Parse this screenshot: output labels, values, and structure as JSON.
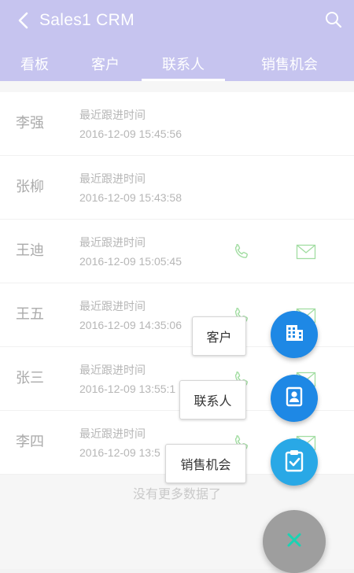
{
  "header": {
    "title": "Sales1 CRM",
    "background": "#b0aee9"
  },
  "tabs": [
    {
      "label": "看板",
      "active": false
    },
    {
      "label": "客户",
      "active": false
    },
    {
      "label": "联系人",
      "active": true
    },
    {
      "label": "销售机会",
      "active": false
    }
  ],
  "contacts": [
    {
      "name": "李强",
      "label": "最近跟进时间",
      "time": "2016-12-09 15:45:56"
    },
    {
      "name": "张柳",
      "label": "最近跟进时间",
      "time": "2016-12-09 15:43:58"
    },
    {
      "name": "王迪",
      "label": "最近跟进时间",
      "time": "2016-12-09 15:05:45"
    },
    {
      "name": "王五",
      "label": "最近跟进时间",
      "time": "2016-12-09 14:35:06"
    },
    {
      "name": "张三",
      "label": "最近跟进时间",
      "time": "2016-12-09 13:55:1"
    },
    {
      "name": "李四",
      "label": "最近跟进时间",
      "time": "2016-12-09 13:5"
    }
  ],
  "footer": {
    "text": "没有更多数据了"
  },
  "fab_menu": {
    "items": [
      {
        "label": "客户",
        "icon": "building-icon",
        "color": "#1e88e5"
      },
      {
        "label": "联系人",
        "icon": "contact-card-icon",
        "color": "#1e88e5"
      },
      {
        "label": "销售机会",
        "icon": "clipboard-check-icon",
        "color": "#29a8e6"
      }
    ],
    "close_icon": "close-icon",
    "close_color": "#19d3b3"
  },
  "colors": {
    "accent": "#b0aee9",
    "icon_green": "#7ed07e"
  }
}
